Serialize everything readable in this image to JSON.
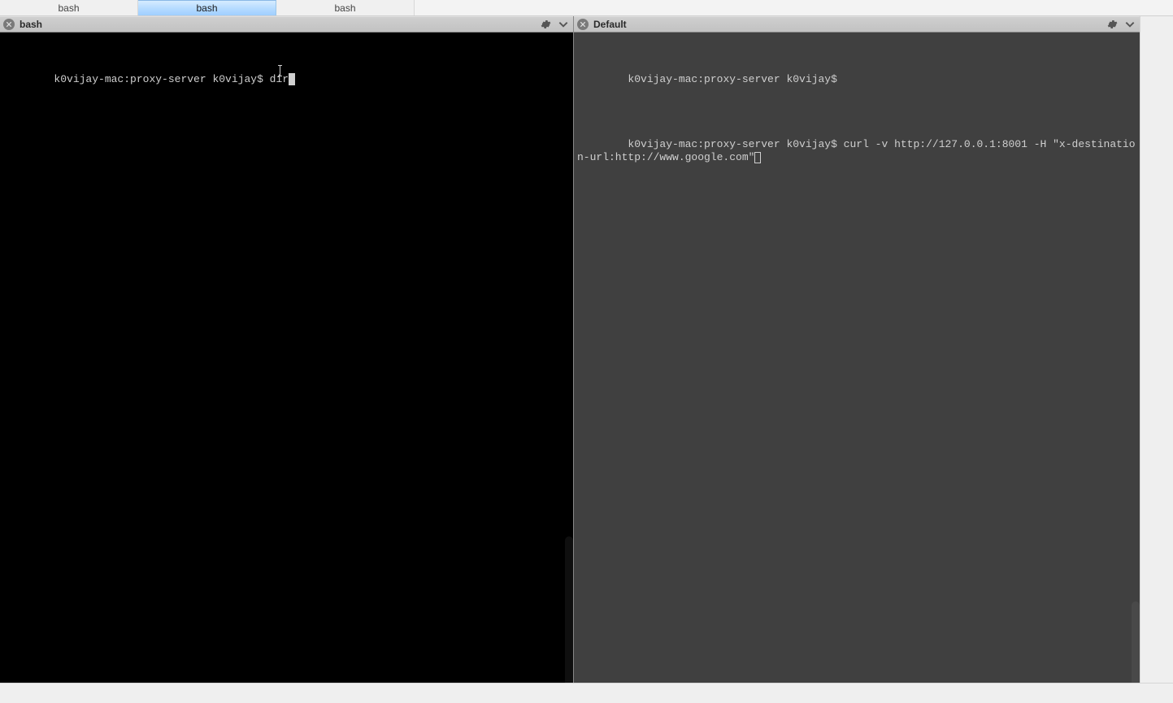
{
  "tabs": {
    "items": [
      {
        "label": "bash",
        "active": false
      },
      {
        "label": "bash",
        "active": true
      },
      {
        "label": "bash",
        "active": false
      }
    ]
  },
  "panes": {
    "left": {
      "header_title": "bash",
      "prompt": "k0vijay-mac:proxy-server k0vijay$ ",
      "command": "dir"
    },
    "right": {
      "header_title": "Default",
      "line1_prompt": "k0vijay-mac:proxy-server k0vijay$",
      "line2_prompt": "k0vijay-mac:proxy-server k0vijay$ ",
      "line2_command": "curl -v http://127.0.0.1:8001 -H \"x-destination-url:http://www.google.com\""
    }
  },
  "icons": {
    "close": "close-icon",
    "gear": "gear-icon",
    "dropdown": "chevron-down-icon"
  }
}
